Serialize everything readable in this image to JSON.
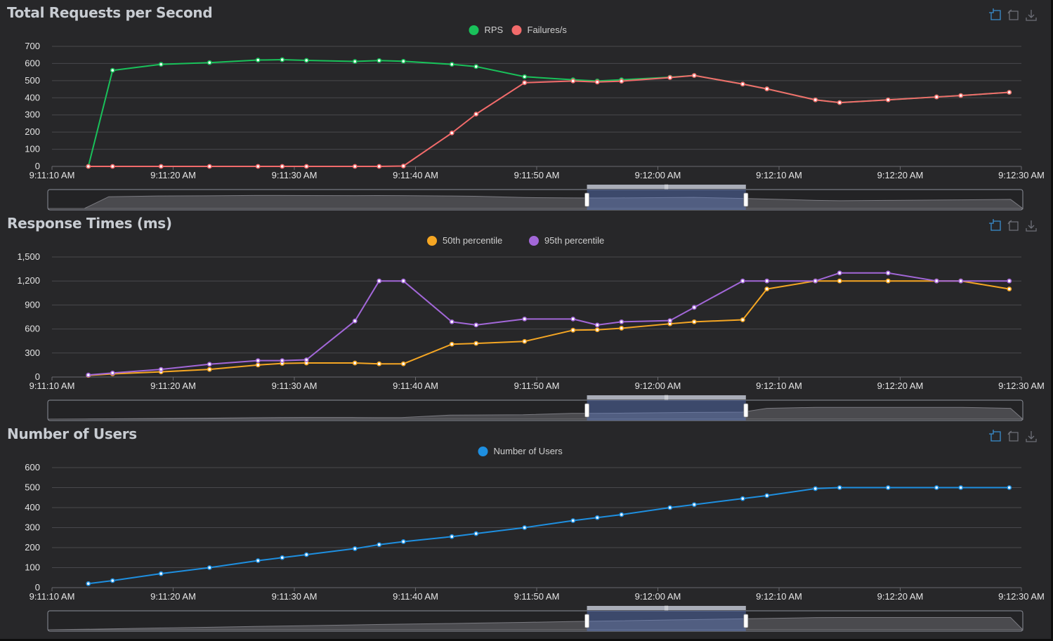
{
  "colors": {
    "background": "#272729",
    "grid": "#48484c",
    "axis_text": "#e4e4e4",
    "title": "#c8ccd2",
    "legend_text": "#cfcfcf",
    "rps": "#19c15a",
    "failures": "#f26b6b",
    "p50": "#f5a623",
    "p95": "#a267d8",
    "users": "#1e8fe0",
    "toolbox": "#3a8fd0"
  },
  "toolbox_icons": [
    "zoom-icon",
    "zoom-reset-icon",
    "download-icon"
  ],
  "x_tick_labels": [
    "9:11:10 AM",
    "9:11:20 AM",
    "9:11:30 AM",
    "9:11:40 AM",
    "9:11:50 AM",
    "9:12:00 AM",
    "9:12:10 AM",
    "9:12:20 AM",
    "9:12:30 AM"
  ],
  "time_points": [
    "9:11:13",
    "9:11:15",
    "9:11:19",
    "9:11:23",
    "9:11:27",
    "9:11:29",
    "9:11:31",
    "9:11:35",
    "9:11:37",
    "9:11:39",
    "9:11:43",
    "9:11:45",
    "9:11:49",
    "9:11:53",
    "9:11:55",
    "9:11:57",
    "9:12:01",
    "9:12:03",
    "9:12:07",
    "9:12:09",
    "9:12:13",
    "9:12:15",
    "9:12:19",
    "9:12:23",
    "9:12:25",
    "9:12:29"
  ],
  "slider_range": [
    0.553,
    0.716
  ],
  "chart_data": [
    {
      "type": "line",
      "title": "Total Requests per Second",
      "ylim": [
        0,
        700
      ],
      "yticks": [
        "0",
        "100",
        "200",
        "300",
        "400",
        "500",
        "600",
        "700"
      ],
      "grid": true,
      "legend": "top-center",
      "series": [
        {
          "name": "RPS",
          "color_key": "rps",
          "values": [
            0,
            560,
            595,
            605,
            620,
            622,
            618,
            612,
            617,
            613,
            595,
            582,
            523,
            505,
            498,
            505,
            520,
            530,
            480,
            452,
            388,
            372,
            388,
            405,
            413,
            432
          ]
        },
        {
          "name": "Failures/s",
          "color_key": "failures",
          "values": [
            0,
            0,
            0,
            0,
            0,
            0,
            0,
            0,
            0,
            2,
            195,
            305,
            488,
            498,
            492,
            497,
            518,
            530,
            480,
            452,
            388,
            372,
            388,
            405,
            413,
            432
          ]
        }
      ]
    },
    {
      "type": "line",
      "title": "Response Times (ms)",
      "ylim": [
        0,
        1500
      ],
      "yticks": [
        "0",
        "300",
        "600",
        "900",
        "1,200",
        "1,500"
      ],
      "grid": true,
      "legend": "top-center",
      "series": [
        {
          "name": "50th percentile",
          "color_key": "p50",
          "values": [
            20,
            40,
            65,
            95,
            150,
            170,
            175,
            175,
            165,
            165,
            410,
            420,
            445,
            585,
            590,
            610,
            665,
            690,
            715,
            1100,
            1200,
            1200,
            1200,
            1200,
            1200,
            1100
          ]
        },
        {
          "name": "95th percentile",
          "color_key": "p95",
          "values": [
            25,
            50,
            95,
            160,
            205,
            205,
            215,
            700,
            1200,
            1200,
            690,
            650,
            725,
            725,
            650,
            690,
            705,
            870,
            1200,
            1200,
            1200,
            1300,
            1300,
            1200,
            1200,
            1200
          ]
        }
      ]
    },
    {
      "type": "line",
      "title": "Number of Users",
      "ylim": [
        0,
        600
      ],
      "yticks": [
        "0",
        "100",
        "200",
        "300",
        "400",
        "500",
        "600"
      ],
      "grid": true,
      "legend": "top-center",
      "series": [
        {
          "name": "Number of Users",
          "color_key": "users",
          "values": [
            20,
            35,
            70,
            100,
            135,
            150,
            165,
            195,
            215,
            230,
            255,
            270,
            300,
            335,
            350,
            365,
            400,
            415,
            445,
            460,
            495,
            500,
            500,
            500,
            500,
            500
          ]
        }
      ]
    }
  ]
}
